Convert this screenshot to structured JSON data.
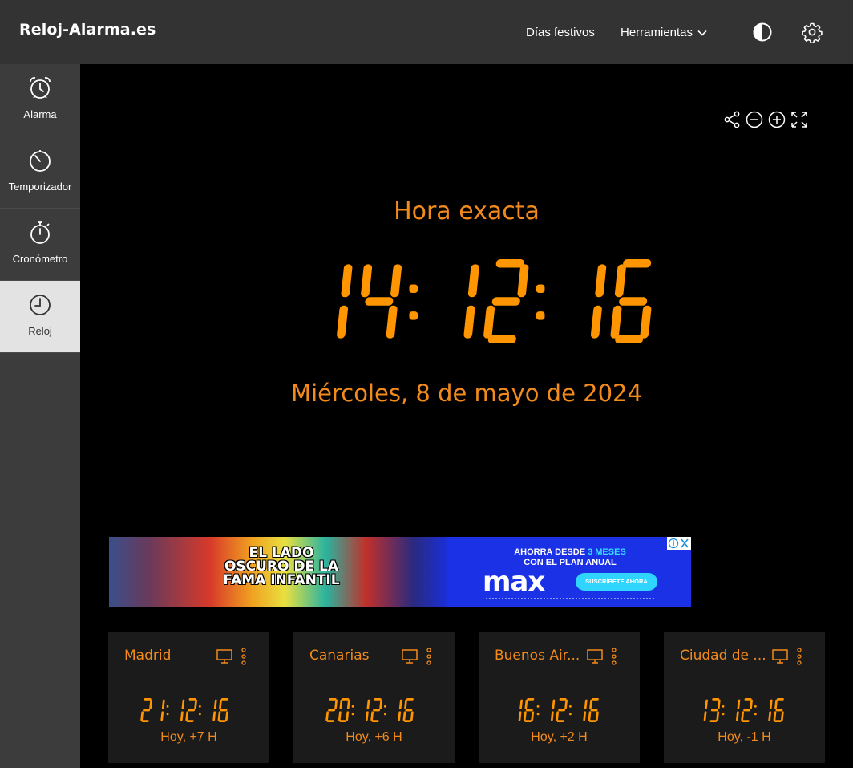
{
  "app": {
    "logo": "Reloj-Alarma.es"
  },
  "nav": {
    "festivos": "Días festivos",
    "herramientas": "Herramientas",
    "icons": [
      "contrast-icon",
      "gear-icon"
    ]
  },
  "sidebar": {
    "items": [
      {
        "label": "Alarma",
        "icon": "alarm-clock-icon",
        "active": false
      },
      {
        "label": "Temporizador",
        "icon": "timer-icon",
        "active": false
      },
      {
        "label": "Cronómetro",
        "icon": "stopwatch-icon",
        "active": false
      },
      {
        "label": "Reloj",
        "icon": "clock-icon",
        "active": true
      }
    ]
  },
  "toolbar": {
    "icons": [
      "share-icon",
      "zoom-out-icon",
      "zoom-in-icon",
      "fullscreen-icon"
    ]
  },
  "clock": {
    "title": "Hora exacta",
    "time": "14:12:16",
    "date": "Miércoles, 8 de mayo de 2024",
    "color": "#f28a1c",
    "digit_color": "#ff9500"
  },
  "ad": {
    "headline": "EL LADO OSCURO DE LA FAMA INFANTIL",
    "promo_prefix": "AHORRA DESDE ",
    "promo_highlight": "3 MESES",
    "promo_line2": "CON EL PLAN ANUAL",
    "brand": "max",
    "cta": "SUSCRÍBETE AHORA"
  },
  "cities": [
    {
      "name": "Madrid",
      "time": "21:12:16",
      "offset": "Hoy, +7 H"
    },
    {
      "name": "Canarias",
      "time": "20:12:16",
      "offset": "Hoy, +6 H"
    },
    {
      "name": "Buenos Air...",
      "time": "16:12:16",
      "offset": "Hoy, +2 H"
    },
    {
      "name": "Ciudad de ...",
      "time": "13:12:16",
      "offset": "Hoy, -1 H"
    }
  ]
}
